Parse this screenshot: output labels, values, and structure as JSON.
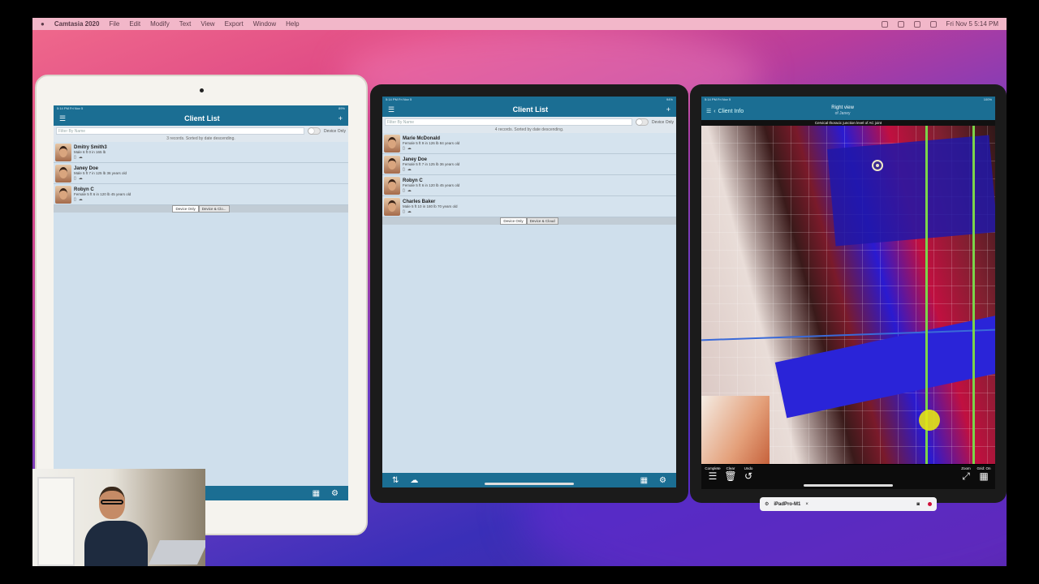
{
  "menubar": {
    "app": "Camtasia 2020",
    "items": [
      "File",
      "Edit",
      "Modify",
      "Text",
      "View",
      "Export",
      "Window",
      "Help"
    ],
    "clock": "Fri Nov 5  5:14 PM"
  },
  "ipad1": {
    "status_time": "5:14 PM  Fri Nov 5",
    "status_right": "89%",
    "title": "Client List",
    "filter_placeholder": "Filter By Name",
    "device_only_label": "Device Only",
    "records": "3 records. Sorted by date descending.",
    "clients": [
      {
        "name": "Dmitry Smith3",
        "desc": "Male 6 ft 0 in 165 lb"
      },
      {
        "name": "Janey Doe",
        "desc": "Male 5 ft 7 in 125 lb 36 years old"
      },
      {
        "name": "Robyn C",
        "desc": "Female 5 ft 6 in 120 lb 45 years old"
      }
    ],
    "seg": [
      "Device Only",
      "Device & Clo..."
    ]
  },
  "ipad2": {
    "status_time": "5:14 PM  Fri Nov 5",
    "status_right": "94%",
    "title": "Client List",
    "filter_placeholder": "Filter By Name",
    "device_only_label": "Device Only",
    "records": "4 records. Sorted by date descending.",
    "clients": [
      {
        "name": "Marie McDonald",
        "desc": "Female 5 ft 9 in 126 lb 84 years old"
      },
      {
        "name": "Janey Doe",
        "desc": "Female 5 ft 7 in 125 lb 36 years old"
      },
      {
        "name": "Robyn C",
        "desc": "Female 5 ft 6 in 120 lb 45 years old"
      },
      {
        "name": "Charles Baker",
        "desc": "Male 5 ft 10 in 180 lb 70 years old"
      }
    ],
    "seg": [
      "Device Only",
      "Device & Cloud"
    ]
  },
  "ipad3": {
    "status_time": "5:14 PM  Fri Nov 5",
    "status_right": "100%",
    "back_label": "Client Info",
    "title": "Right view",
    "subtitle": "of Janey",
    "caption": "Cervical thoracic junction level of AC joint",
    "tools_left": [
      {
        "label": "Complete",
        "glyph": "☰"
      },
      {
        "label": "Clear",
        "glyph": "🗑"
      },
      {
        "label": "Undo",
        "glyph": "↺"
      }
    ],
    "tools_right": [
      {
        "label": "Zoom",
        "glyph": "⤢"
      },
      {
        "label": "Grid: On",
        "glyph": "▦"
      }
    ]
  },
  "recorder": {
    "device": "iPadPro-M1",
    "close": "×"
  }
}
